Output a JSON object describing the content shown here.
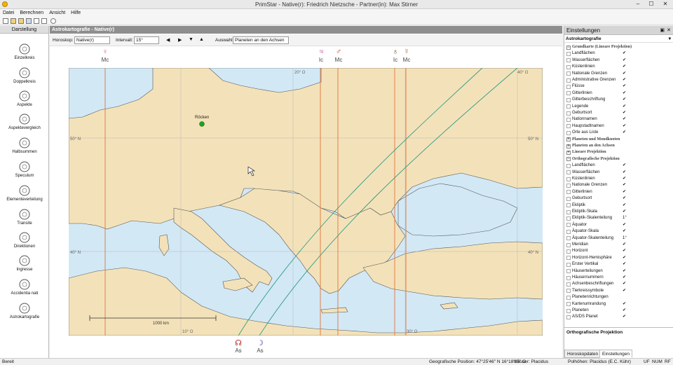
{
  "window": {
    "title": "PrimStar - Native(r): Friedrich Nietzsche - Partner(in): Max Stirner",
    "min": "–",
    "max": "☐",
    "close": "✕"
  },
  "menu": [
    "Datei",
    "Berechnen",
    "Ansicht",
    "Hilfe"
  ],
  "left": {
    "header": "Darstellung",
    "items": [
      {
        "label": "Einzelkreis",
        "icon": "single-circle-icon"
      },
      {
        "label": "Doppelkreis",
        "icon": "double-circle-icon"
      },
      {
        "label": "Aspekte",
        "icon": "aspects-icon"
      },
      {
        "label": "Aspektevergleich",
        "icon": "aspect-comparison-icon"
      },
      {
        "label": "Halbsummen",
        "icon": "midpoints-icon"
      },
      {
        "label": "Speculum",
        "icon": "speculum-icon"
      },
      {
        "label": "Elementeverteilung",
        "icon": "element-distribution-icon"
      },
      {
        "label": "Transite",
        "icon": "transits-icon"
      },
      {
        "label": "Direktionen",
        "icon": "directions-icon"
      },
      {
        "label": "Ingresse",
        "icon": "ingresses-icon"
      },
      {
        "label": "Accidentia nati",
        "icon": "accidentia-icon"
      },
      {
        "label": "Astrokartografie",
        "icon": "astrocartography-icon"
      }
    ]
  },
  "center": {
    "header": "Astrokartografie - Native(r)",
    "controls": {
      "horoskop_label": "Horoskop:",
      "horoskop_value": "Native(r)",
      "intervall_label": "Intervall:",
      "intervall_value": "15°",
      "auswahl_label": "Auswahl:",
      "auswahl_value": "Planeten an den Achsen"
    },
    "map": {
      "place_label": "Röcken",
      "lat_labels": [
        "50° N",
        "40° N",
        "30° N"
      ],
      "lon_labels": [
        "10° O",
        "20° O",
        "30° O",
        "40° O"
      ],
      "scale_label": "1000 km",
      "colors": {
        "land": "#f3e2b9",
        "sea": "#d2e8f5",
        "mc_ic": "#e0753a",
        "as_line": "#2e9a84"
      }
    },
    "top_lines": [
      {
        "glyph": "♀",
        "label": "Mc",
        "color": "#d45a9b"
      },
      {
        "glyph": "♃",
        "label": "Ic",
        "color": "#b51e7c"
      },
      {
        "glyph": "♂",
        "label": "Mc",
        "color": "#d0281f"
      },
      {
        "glyph": "♁",
        "label": "Ic",
        "color": "#6f4e2a"
      },
      {
        "glyph": "☿",
        "label": "Mc",
        "color": "#a06a2a"
      }
    ],
    "bottom_lines": [
      {
        "glyph": "☊",
        "label": "As",
        "color": "#b71c1c"
      },
      {
        "glyph": "☽",
        "label": "As",
        "color": "#2233aa"
      }
    ]
  },
  "right": {
    "header": "Einstellungen",
    "subheader": "Astrokartografie",
    "groups": [
      {
        "title": "Grundkarte (Lineare Projektion)",
        "expanded": true,
        "items": [
          {
            "label": "Landflächen",
            "value": "✔"
          },
          {
            "label": "Wasserflächen",
            "value": "✔"
          },
          {
            "label": "Küstenlinien",
            "value": "✔"
          },
          {
            "label": "Nationale Grenzen",
            "value": "✔"
          },
          {
            "label": "Administrative Grenzen",
            "value": "✔"
          },
          {
            "label": "Flüsse",
            "value": "✔"
          },
          {
            "label": "Gitterlinien",
            "value": "✔"
          },
          {
            "label": "Gitterbeschriftung",
            "value": "✔"
          },
          {
            "label": "Legende",
            "value": "✔"
          },
          {
            "label": "Geburtsort",
            "value": "✔"
          },
          {
            "label": "Nationnamen",
            "value": "✔"
          },
          {
            "label": "Haupstadtnamen",
            "value": "✔"
          },
          {
            "label": "Orte aus Liste",
            "value": "✔"
          }
        ]
      },
      {
        "title": "Planeten und Mondknoten",
        "expanded": false,
        "items": []
      },
      {
        "title": "Planeten an den Achsen",
        "expanded": false,
        "items": []
      },
      {
        "title": "Lineare Projektion",
        "expanded": false,
        "items": []
      },
      {
        "title": "Orthografische Projektion",
        "expanded": true,
        "items": [
          {
            "label": "Landflächen",
            "value": "✔"
          },
          {
            "label": "Wasserflächen",
            "value": "✔"
          },
          {
            "label": "Küstenlinien",
            "value": "✔"
          },
          {
            "label": "Nationale Grenzen",
            "value": "✔"
          },
          {
            "label": "Gitterlinien",
            "value": "✔"
          },
          {
            "label": "Geburtsort",
            "value": "✔"
          },
          {
            "label": "Ekliptik",
            "value": "✔"
          },
          {
            "label": "Ekliptik-Skala",
            "value": "✔"
          },
          {
            "label": "Ekliptik-Skalenteilung",
            "value": "1°"
          },
          {
            "label": "Äquator",
            "value": "✔"
          },
          {
            "label": "Äquator-Skala",
            "value": "✔"
          },
          {
            "label": "Äquator-Skalenteilung",
            "value": "1°"
          },
          {
            "label": "Meridian",
            "value": "✔"
          },
          {
            "label": "Horizont",
            "value": "✔"
          },
          {
            "label": "Horizont-Hemisphäre",
            "value": "✔"
          },
          {
            "label": "Erster Vertikal",
            "value": "✔"
          },
          {
            "label": "Häuserteilungen",
            "value": "✔"
          },
          {
            "label": "Häusernummern",
            "value": "✔"
          },
          {
            "label": "Achsenbeschriftungen",
            "value": "✔"
          },
          {
            "label": "Tierkreissymbole",
            "value": "✔"
          },
          {
            "label": "Planetenrichtungen",
            "value": ""
          },
          {
            "label": "Kartenumrandung",
            "value": "✔"
          },
          {
            "label": "Planeten",
            "value": "✔"
          },
          {
            "label": "AS/DS Planet",
            "value": "✔"
          }
        ]
      }
    ],
    "description": "Orthografische Projektion",
    "tabs": [
      "Horoskopdaten",
      "Einstellungen"
    ]
  },
  "status": {
    "left": "Bereit",
    "position": "Geografische Position: 47°25'46\" N  16°18'15\" O",
    "houses": "Häuser: Placidus",
    "poles": "Polhöhen: Placidus (E.C. Kühr)",
    "uf": "UF",
    "num": "NUM",
    "rf": "RF"
  }
}
